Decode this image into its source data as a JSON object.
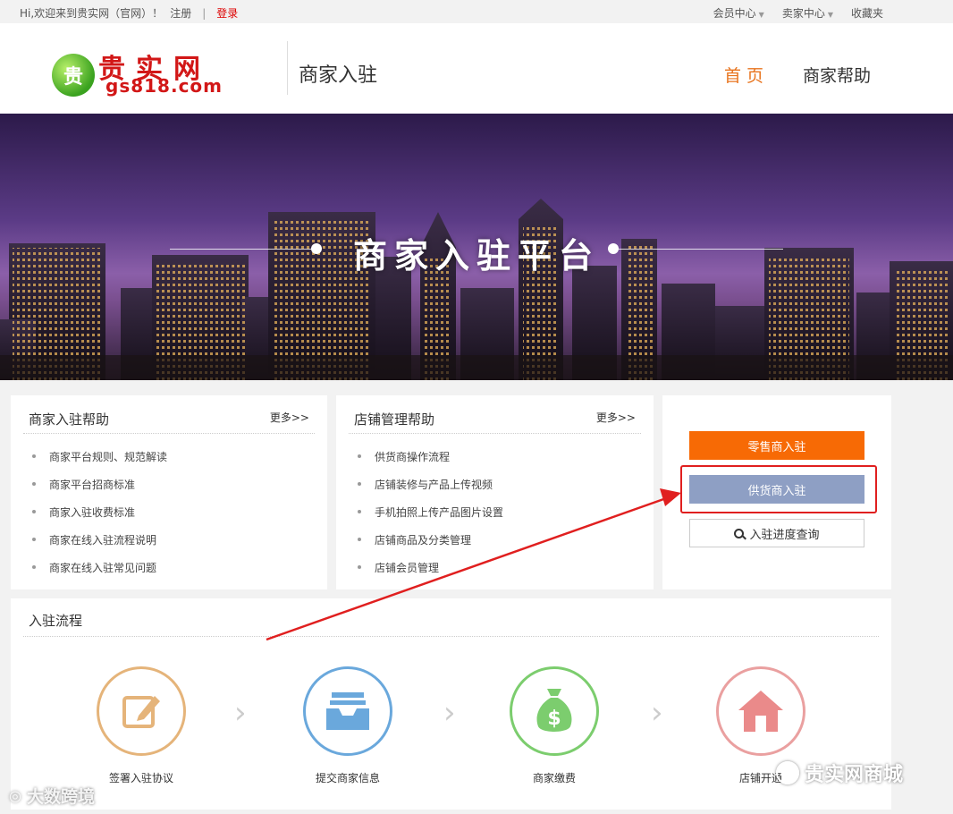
{
  "topbar": {
    "welcome": "Hi,欢迎来到贵实网（官网）！",
    "register": "注册",
    "separator": "|",
    "login": "登录",
    "member_center": "会员中心",
    "seller_center": "卖家中心",
    "favorites": "收藏夹"
  },
  "header": {
    "logo_badge": "贵",
    "logo_cn": "贵实网",
    "logo_en": "gs818.com",
    "site_title": "商家入驻",
    "nav": {
      "home": "首页",
      "help": "商家帮助"
    }
  },
  "banner": {
    "title": "商家入驻平台"
  },
  "help_panel": {
    "title": "商家入驻帮助",
    "more": "更多>>",
    "items": [
      "商家平台规则、规范解读",
      "商家平台招商标准",
      "商家入驻收费标准",
      "商家在线入驻流程说明",
      "商家在线入驻常见问题"
    ]
  },
  "shop_panel": {
    "title": "店铺管理帮助",
    "more": "更多>>",
    "items": [
      "供货商操作流程",
      "店铺装修与产品上传视频",
      "手机拍照上传产品图片设置",
      "店铺商品及分类管理",
      "店铺会员管理"
    ]
  },
  "actions": {
    "retail": "零售商入驻",
    "supplier": "供货商入驻",
    "progress": "入驻进度查询"
  },
  "process": {
    "title": "入驻流程",
    "steps": [
      {
        "label": "签署入驻协议",
        "color": "#e5b47a"
      },
      {
        "label": "提交商家信息",
        "color": "#6aa8dc"
      },
      {
        "label": "商家缴费",
        "color": "#7ccd6e"
      },
      {
        "label": "店铺开通",
        "color": "#eaa0a0"
      }
    ]
  },
  "watermarks": {
    "left": "大数跨境",
    "right": "贵实网商城"
  }
}
